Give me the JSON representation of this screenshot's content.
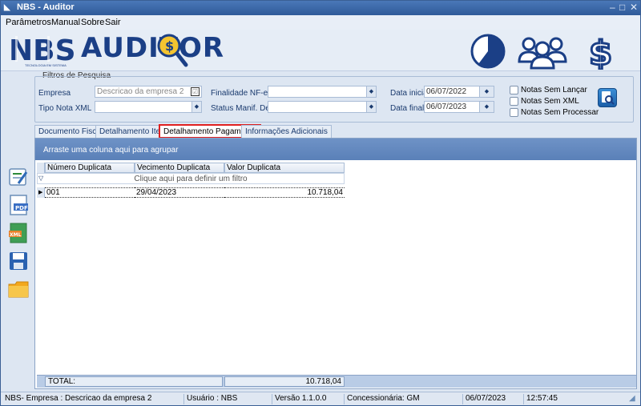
{
  "window": {
    "title": "NBS - Auditor"
  },
  "menu": [
    "Parâmetros",
    "Manual",
    "Sobre",
    "Sair"
  ],
  "banner": {
    "logo_text": "AUDITOR",
    "logo_sub": "TECNOLOGIA EM SISTEMA"
  },
  "filters": {
    "legend": "Filtros de Pesquisa",
    "empresa_label": "Empresa",
    "empresa_value": "Descricao da empresa 2",
    "tipo_nota_label": "Tipo Nota XML",
    "tipo_nota_value": "",
    "finalidade_label": "Finalidade NF-e",
    "finalidade_value": "",
    "status_label": "Status Manif. Dest:",
    "status_value": "",
    "data_inicial_label": "Data inicial",
    "data_inicial_value": "06/07/2022",
    "data_final_label": "Data final",
    "data_final_value": "06/07/2023",
    "chk_sem_lancar": "Notas Sem Lançar",
    "chk_sem_xml": "Notas Sem XML",
    "chk_sem_processar": "Notas Sem Processar"
  },
  "tabs": [
    "Documento Fiscais",
    "Detalhamento Itens",
    "Detalhamento Pagamento",
    "Informações Adicionais"
  ],
  "grid": {
    "group_hint": "Arraste uma coluna aqui para agrupar",
    "columns": [
      "Número Duplicata",
      "Vecimento Duplicata",
      "Valor Duplicata"
    ],
    "filter_hint": "Clique aqui para definir um filtro",
    "rows": [
      {
        "numero": "001",
        "vencimento": "29/04/2023",
        "valor": "10.718,04"
      }
    ],
    "total_label": "TOTAL:",
    "total_value": "10.718,04"
  },
  "status": {
    "empresa": "NBS- Empresa : Descricao da empresa 2",
    "usuario": "Usuário : NBS",
    "versao": "Versão 1.1.0.0",
    "concessionaria": "Concessionária: GM",
    "data": "06/07/2023",
    "hora": "12:57:45"
  },
  "colors": {
    "accent": "#1b3f86",
    "tab_highlight": "#e02020",
    "group_bar": "#6e92c6"
  }
}
